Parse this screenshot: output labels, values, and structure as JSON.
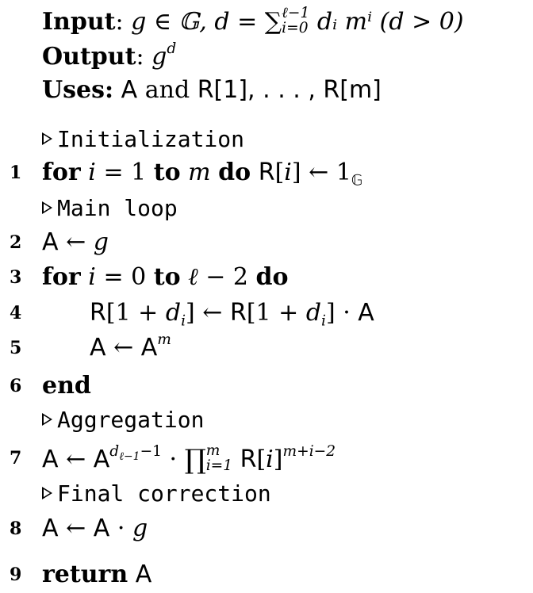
{
  "algorithm": {
    "header": {
      "input_label": "Input",
      "input_text": "g ∈ 𝔾, d = ∑",
      "input_sum_upper": "ℓ−1",
      "input_sum_lower": "i=0",
      "input_tail": "dᵢ mⁱ  (d > 0)",
      "output_label": "Output",
      "output_text": "g",
      "output_sup": "d",
      "uses_label": "Uses:",
      "uses_text_a": "A",
      "uses_text_and": "and",
      "uses_text_list": "R[1], . . . , R[m]"
    },
    "comments": {
      "init": "Initialization",
      "main": "Main loop",
      "agg": "Aggregation",
      "final": "Final correction"
    },
    "lines": [
      {
        "no": "1",
        "text": "for i = 1 to m do R[i] ← 1𝔾"
      },
      {
        "no": "2",
        "text": "A ← g"
      },
      {
        "no": "3",
        "text": "for i = 0 to ℓ − 2 do"
      },
      {
        "no": "4",
        "text": "R[1 + dᵢ] ← R[1 + dᵢ] · A"
      },
      {
        "no": "5",
        "text": "A ← Aᵐ"
      },
      {
        "no": "6",
        "text": "end"
      },
      {
        "no": "7",
        "text": "A ← A^(d_{ℓ−1}−1) · ∏_{i=1}^{m} R[i]^(m+i−2)"
      },
      {
        "no": "8",
        "text": "A ← A · g"
      },
      {
        "no": "9",
        "text": "return A"
      }
    ]
  }
}
